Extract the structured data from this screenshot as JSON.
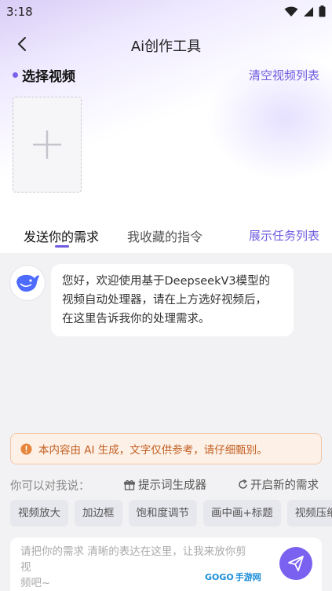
{
  "status_bar": {
    "time": "3:18"
  },
  "header": {
    "title": "Ai创作工具"
  },
  "video_section": {
    "title": "选择视频",
    "clear_label": "清空视频列表"
  },
  "tabs": {
    "items": [
      {
        "label": "发送你的需求"
      },
      {
        "label": "我收藏的指令"
      }
    ],
    "task_list_label": "展示任务列表"
  },
  "chat": {
    "message_lines": [
      "您好，欢迎使用基于DeepseekV3模型的",
      "视频自动处理器，请在上方选好视频后，",
      "在这里告诉我你的处理需求。"
    ]
  },
  "notice": {
    "text": "本内容由 AI 生成，文字仅供参考，请仔细甄别。"
  },
  "suggest": {
    "label": "你可以对我说：",
    "prompt_gen_label": "提示词生成器",
    "new_request_label": "开启新的需求",
    "chips": [
      "视频放大",
      "加边框",
      "饱和度调节",
      "画中画+标题",
      "视频压缩"
    ]
  },
  "input": {
    "placeholder_lines": [
      "请把你的需求 清晰的表达在这里，让我来放你剪视",
      "频吧~"
    ]
  },
  "watermark": {
    "logo": "GOGO",
    "text": "手游网"
  },
  "colors": {
    "accent": "#7b61f0",
    "notice_text": "#c25f22"
  }
}
